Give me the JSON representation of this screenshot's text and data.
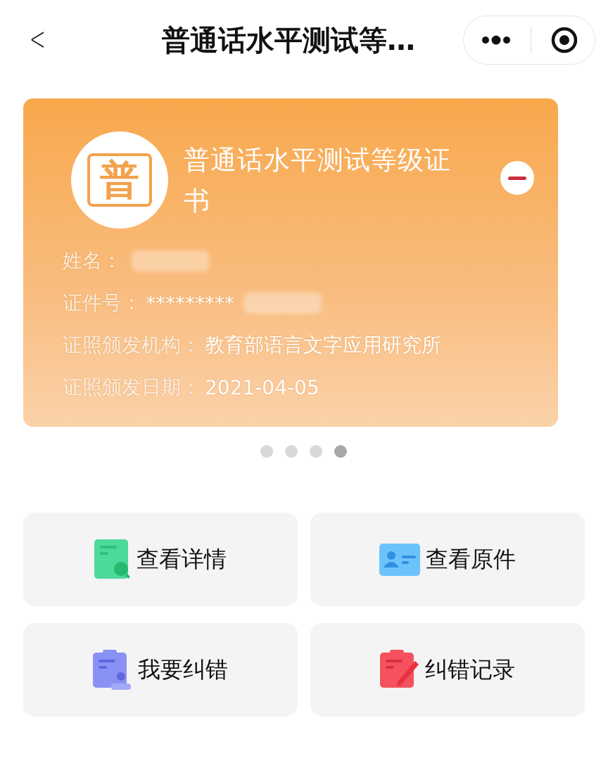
{
  "nav": {
    "back": "<",
    "title": "普通话水平测试等…"
  },
  "card": {
    "logo": "普",
    "title": "普通话水平测试等级证书",
    "fields": [
      {
        "label": "姓名：",
        "redacted": true
      },
      {
        "label": "证件号：",
        "value": "*********",
        "redacted": true
      },
      {
        "label": "证照颁发机构：",
        "value": "教育部语言文字应用研究所",
        "redacted": false
      },
      {
        "label": "证照颁发日期：",
        "value": "2021-04-05",
        "redacted": false
      }
    ]
  },
  "pager": [
    {
      "selected": false
    },
    {
      "selected": false
    },
    {
      "selected": false
    },
    {
      "selected": true
    }
  ],
  "actions": [
    {
      "label": "查看详情",
      "kind": "details"
    },
    {
      "label": "查看原件",
      "kind": "original"
    },
    {
      "label": "我要纠错",
      "kind": "correct"
    },
    {
      "label": "纠错记录",
      "kind": "records"
    }
  ]
}
